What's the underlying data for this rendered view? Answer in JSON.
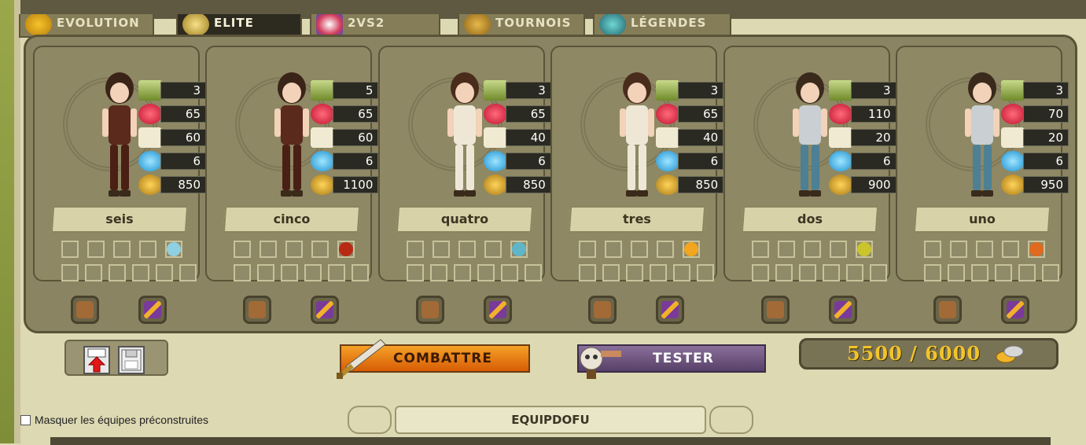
{
  "tabs": [
    {
      "label": "EVOLUTION",
      "active": false
    },
    {
      "label": "ELITE",
      "active": true
    },
    {
      "label": "2VS2",
      "active": false
    },
    {
      "label": "TOURNOIS",
      "active": false
    },
    {
      "label": "LÉGENDES",
      "active": false
    }
  ],
  "team": [
    {
      "name": "seis",
      "level": "3",
      "hp": "65",
      "initiative": "60",
      "ap": "6",
      "cost": "850",
      "gem_color": "#8fd0e0",
      "look": "female-armor"
    },
    {
      "name": "cinco",
      "level": "5",
      "hp": "65",
      "initiative": "60",
      "ap": "6",
      "cost": "1100",
      "gem_color": "#b82a14",
      "look": "female-armor"
    },
    {
      "name": "quatro",
      "level": "3",
      "hp": "65",
      "initiative": "40",
      "ap": "6",
      "cost": "850",
      "gem_color": "#5fb6c8",
      "look": "female-light"
    },
    {
      "name": "tres",
      "level": "3",
      "hp": "65",
      "initiative": "40",
      "ap": "6",
      "cost": "850",
      "gem_color": "#f2a51f",
      "look": "female-light"
    },
    {
      "name": "dos",
      "level": "3",
      "hp": "110",
      "initiative": "20",
      "ap": "6",
      "cost": "900",
      "gem_color": "#c9c52a",
      "look": "male-blue"
    },
    {
      "name": "uno",
      "level": "3",
      "hp": "70",
      "initiative": "20",
      "ap": "6",
      "cost": "950",
      "gem_color": "#e06a1f",
      "look": "male-blue"
    }
  ],
  "actions": {
    "fight_label": "COMBATTRE",
    "test_label": "TESTER",
    "budget": "5500 / 6000"
  },
  "filters": {
    "hide_prebuilt_label": "Masquer les équipes préconstruites",
    "hide_prebuilt_checked": false
  },
  "team_name": "EQUIPDOFU"
}
